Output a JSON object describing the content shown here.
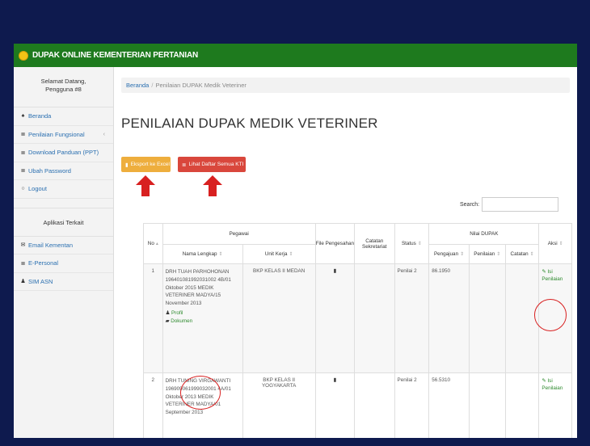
{
  "topbar": {
    "title": "DUPAK ONLINE KEMENTERIAN PERTANIAN"
  },
  "sidebar": {
    "welcome_line1": "Selamat Datang,",
    "welcome_line2": "Pengguna #8",
    "items": [
      {
        "icon": "home-icon",
        "glyph": "♠",
        "label": "Beranda"
      },
      {
        "icon": "list-icon",
        "glyph": "≣",
        "label": "Penilaian Fungsional",
        "chevron": "‹"
      },
      {
        "icon": "list-icon",
        "glyph": "≣",
        "label": "Download Panduan (PPT)"
      },
      {
        "icon": "list-icon",
        "glyph": "≣",
        "label": "Ubah Password"
      },
      {
        "icon": "power-icon",
        "glyph": "○",
        "label": "Logout"
      }
    ],
    "section_title": "Aplikasi Terkait",
    "links": [
      {
        "icon": "email-icon",
        "glyph": "✉",
        "label": "Email Kementan"
      },
      {
        "icon": "list-icon",
        "glyph": "≣",
        "label": "E-Personal"
      },
      {
        "icon": "user-icon",
        "glyph": "♟",
        "label": "SIM ASN"
      }
    ]
  },
  "breadcrumb": {
    "home": "Beranda",
    "separator": "/",
    "current": "Penilaian DUPAK Medik Veteriner"
  },
  "page_title": "PENILAIAN DUPAK MEDIK VETERINER",
  "buttons": {
    "export": "Eksport ke Excel",
    "list_all": "Lihat Daftar Semua KTI"
  },
  "search": {
    "label": "Search:",
    "value": ""
  },
  "table": {
    "headers": {
      "no": "No",
      "pegawai": "Pegawai",
      "nama": "Nama Lengkap",
      "unit": "Unit Kerja",
      "file": "File Pengesahan",
      "catatan_sekretariat": "Catatan Sekretariat",
      "status": "Status",
      "nilai": "Nilai DUPAK",
      "pengajuan": "Pengajuan",
      "penilaian": "Penilaian",
      "catatan": "Catatan",
      "aksi": "Aksi"
    },
    "rows": [
      {
        "no": "1",
        "nama": "DRH TUAH PARHOHONAN 196401081992031002 4B/01 Oktober 2015 MEDIK VETERINER MADYA/15 November 2013",
        "profil": "Profil",
        "dokumen": "Dokumen",
        "unit": "BKP KELAS II MEDAN",
        "status": "Penilai 2",
        "pengajuan": "86.1950",
        "aksi": "Isi Penilaian"
      },
      {
        "no": "2",
        "nama": "DRH TUNING VIRGAWANTI 196909061999032001 4A/01 Oktober 2013 MEDIK VETERINER MADYA/01 September 2013",
        "unit": "BKP KELAS II YOGYAKARTA",
        "status": "Penilai 2",
        "pengajuan": "56.5310",
        "aksi": "Isi Penilaian"
      }
    ]
  },
  "colors": {
    "topbar": "#1e7a1e",
    "export_button": "#eeae3d",
    "list_button": "#d9473c",
    "annotation": "#d82020",
    "link": "#2d8a2d"
  }
}
